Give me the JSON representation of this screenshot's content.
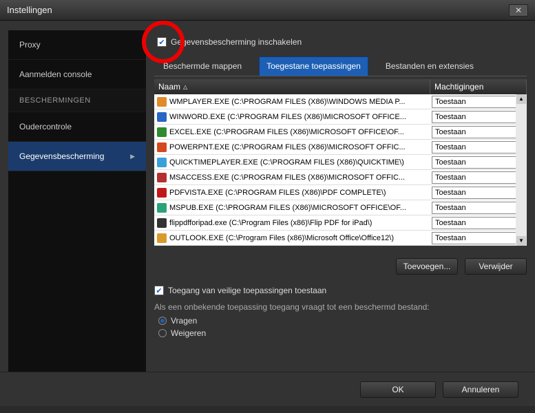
{
  "window": {
    "title": "Instellingen"
  },
  "sidebar": {
    "items": [
      {
        "label": "Proxy",
        "type": "item"
      },
      {
        "label": "Aanmelden console",
        "type": "item"
      },
      {
        "label": "BESCHERMINGEN",
        "type": "group"
      },
      {
        "label": "Oudercontrole",
        "type": "item"
      },
      {
        "label": "Gegevensbescherming",
        "type": "item",
        "active": true
      }
    ]
  },
  "main": {
    "enable_label": "Gegevensbescherming inschakelen",
    "tabs": [
      {
        "label": "Beschermde mappen"
      },
      {
        "label": "Toegestane toepassingen",
        "active": true
      },
      {
        "label": "Bestanden en extensies"
      }
    ],
    "columns": {
      "name": "Naam",
      "perm": "Machtigingen"
    },
    "perm_default": "Toestaan",
    "rows": [
      {
        "name": "WMPLAYER.EXE (C:\\PROGRAM FILES (X86)\\WINDOWS MEDIA P...",
        "icon": "#e08a2a",
        "perm": "Toestaan"
      },
      {
        "name": "WINWORD.EXE (C:\\PROGRAM FILES (X86)\\MICROSOFT OFFICE...",
        "icon": "#2a66c4",
        "perm": "Toestaan"
      },
      {
        "name": "EXCEL.EXE (C:\\PROGRAM FILES (X86)\\MICROSOFT OFFICE\\OF...",
        "icon": "#2e8b2e",
        "perm": "Toestaan"
      },
      {
        "name": "POWERPNT.EXE (C:\\PROGRAM FILES (X86)\\MICROSOFT OFFIC...",
        "icon": "#d24a1f",
        "perm": "Toestaan"
      },
      {
        "name": "QUICKTIMEPLAYER.EXE (C:\\PROGRAM FILES (X86)\\QUICKTIME\\)",
        "icon": "#3aa0d8",
        "perm": "Toestaan"
      },
      {
        "name": "MSACCESS.EXE (C:\\PROGRAM FILES (X86)\\MICROSOFT OFFIC...",
        "icon": "#b43030",
        "perm": "Toestaan"
      },
      {
        "name": "PDFVISTA.EXE (C:\\PROGRAM FILES (X86)\\PDF COMPLETE\\)",
        "icon": "#c01818",
        "perm": "Toestaan"
      },
      {
        "name": "MSPUB.EXE (C:\\PROGRAM FILES (X86)\\MICROSOFT OFFICE\\OF...",
        "icon": "#2aa37a",
        "perm": "Toestaan"
      },
      {
        "name": "flippdfforipad.exe (C:\\Program Files (x86)\\Flip PDF for iPad\\)",
        "icon": "#333333",
        "perm": "Toestaan"
      },
      {
        "name": "OUTLOOK.EXE (C:\\Program Files (x86)\\Microsoft Office\\Office12\\)",
        "icon": "#d89a2a",
        "perm": "Toestaan"
      }
    ],
    "add_label": "Toevoegen...",
    "remove_label": "Verwijder",
    "allow_safe_label": "Toegang van veilige toepassingen toestaan",
    "help_text": "Als een onbekende toepassing toegang vraagt tot een beschermd bestand:",
    "radio_ask": "Vragen",
    "radio_deny": "Weigeren"
  },
  "footer": {
    "ok": "OK",
    "cancel": "Annuleren"
  }
}
